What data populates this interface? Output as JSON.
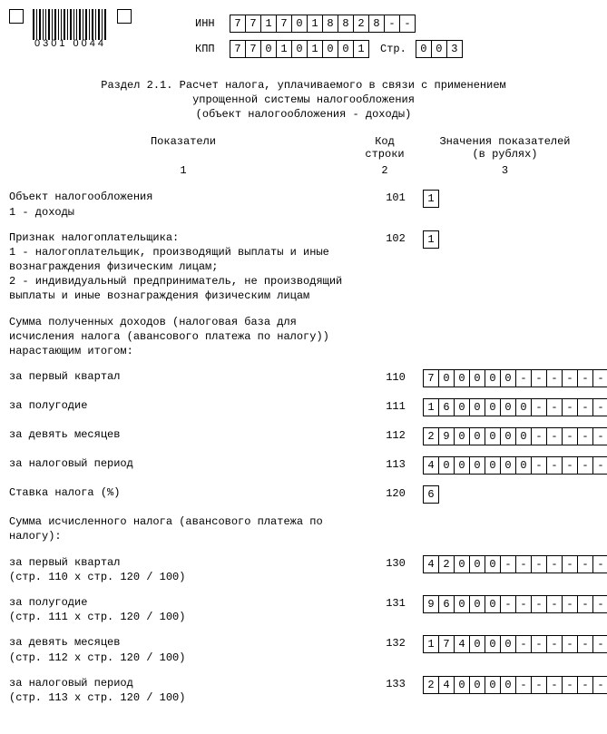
{
  "header": {
    "barcode_label": "0301 0044",
    "inn_label": "ИНН",
    "kpp_label": "КПП",
    "page_label": "Стр.",
    "inn": [
      "7",
      "7",
      "1",
      "7",
      "0",
      "1",
      "8",
      "8",
      "2",
      "8",
      "-",
      "-"
    ],
    "kpp": [
      "7",
      "7",
      "0",
      "1",
      "0",
      "1",
      "0",
      "0",
      "1"
    ],
    "page": [
      "0",
      "0",
      "3"
    ]
  },
  "section_title": {
    "l1": "Раздел 2.1. Расчет налога, уплачиваемого в связи с применением",
    "l2": "упрощенной системы налогообложения",
    "l3": "(объект налогообложения - доходы)"
  },
  "col_headers": {
    "h1": "Показатели",
    "h2a": "Код",
    "h2b": "строки",
    "h3a": "Значения показателей",
    "h3b": "(в рублях)",
    "n1": "1",
    "n2": "2",
    "n3": "3"
  },
  "rows": [
    {
      "code": "101",
      "desc_lines": [
        "Объект налогообложения",
        "1 - доходы"
      ],
      "cells_mode": "one",
      "value": [
        "1"
      ]
    },
    {
      "code": "102",
      "desc_lines": [
        "Признак налогоплательщика:",
        "1 - налогоплательщик, производящий выплаты и иные вознаграждения физическим лицам;",
        "2 - индивидуальный предприниматель, не производящий выплаты и иные вознаграждения физическим лицам"
      ],
      "cells_mode": "one",
      "value": [
        "1"
      ]
    },
    {
      "note_only": true,
      "desc_lines": [
        "Сумма полученных доходов (налоговая база для исчисления налога (авансового платежа по налогу)) нарастающим итогом:"
      ]
    },
    {
      "code": "110",
      "desc_lines": [
        "за первый квартал"
      ],
      "cells_mode": "twelve",
      "value": [
        "7",
        "0",
        "0",
        "0",
        "0",
        "0",
        "-",
        "-",
        "-",
        "-",
        "-",
        "-"
      ]
    },
    {
      "code": "111",
      "desc_lines": [
        "за полугодие"
      ],
      "cells_mode": "twelve",
      "value": [
        "1",
        "6",
        "0",
        "0",
        "0",
        "0",
        "0",
        "-",
        "-",
        "-",
        "-",
        "-"
      ]
    },
    {
      "code": "112",
      "desc_lines": [
        "за девять месяцев"
      ],
      "cells_mode": "twelve",
      "value": [
        "2",
        "9",
        "0",
        "0",
        "0",
        "0",
        "0",
        "-",
        "-",
        "-",
        "-",
        "-"
      ]
    },
    {
      "code": "113",
      "desc_lines": [
        "за налоговый период"
      ],
      "cells_mode": "twelve",
      "value": [
        "4",
        "0",
        "0",
        "0",
        "0",
        "0",
        "0",
        "-",
        "-",
        "-",
        "-",
        "-"
      ]
    },
    {
      "code": "120",
      "desc_lines": [
        "Ставка налога (%)"
      ],
      "cells_mode": "one",
      "value": [
        "6"
      ]
    },
    {
      "note_only": true,
      "desc_lines": [
        "Сумма исчисленного налога (авансового платежа по налогу):"
      ]
    },
    {
      "code": "130",
      "desc_lines": [
        "за первый квартал",
        "(стр. 110 х стр. 120 / 100)"
      ],
      "cells_mode": "twelve",
      "value": [
        "4",
        "2",
        "0",
        "0",
        "0",
        "-",
        "-",
        "-",
        "-",
        "-",
        "-",
        "-"
      ]
    },
    {
      "code": "131",
      "desc_lines": [
        "за полугодие",
        "(стр. 111 х стр. 120 / 100)"
      ],
      "cells_mode": "twelve",
      "value": [
        "9",
        "6",
        "0",
        "0",
        "0",
        "-",
        "-",
        "-",
        "-",
        "-",
        "-",
        "-"
      ]
    },
    {
      "code": "132",
      "desc_lines": [
        "за девять месяцев",
        "(стр. 112 х стр. 120 / 100)"
      ],
      "cells_mode": "twelve",
      "value": [
        "1",
        "7",
        "4",
        "0",
        "0",
        "0",
        "-",
        "-",
        "-",
        "-",
        "-",
        "-"
      ]
    },
    {
      "code": "133",
      "desc_lines": [
        "за налоговый период",
        "(стр. 113 х стр. 120 / 100)"
      ],
      "cells_mode": "twelve",
      "value": [
        "2",
        "4",
        "0",
        "0",
        "0",
        "0",
        "-",
        "-",
        "-",
        "-",
        "-",
        "-"
      ]
    }
  ]
}
